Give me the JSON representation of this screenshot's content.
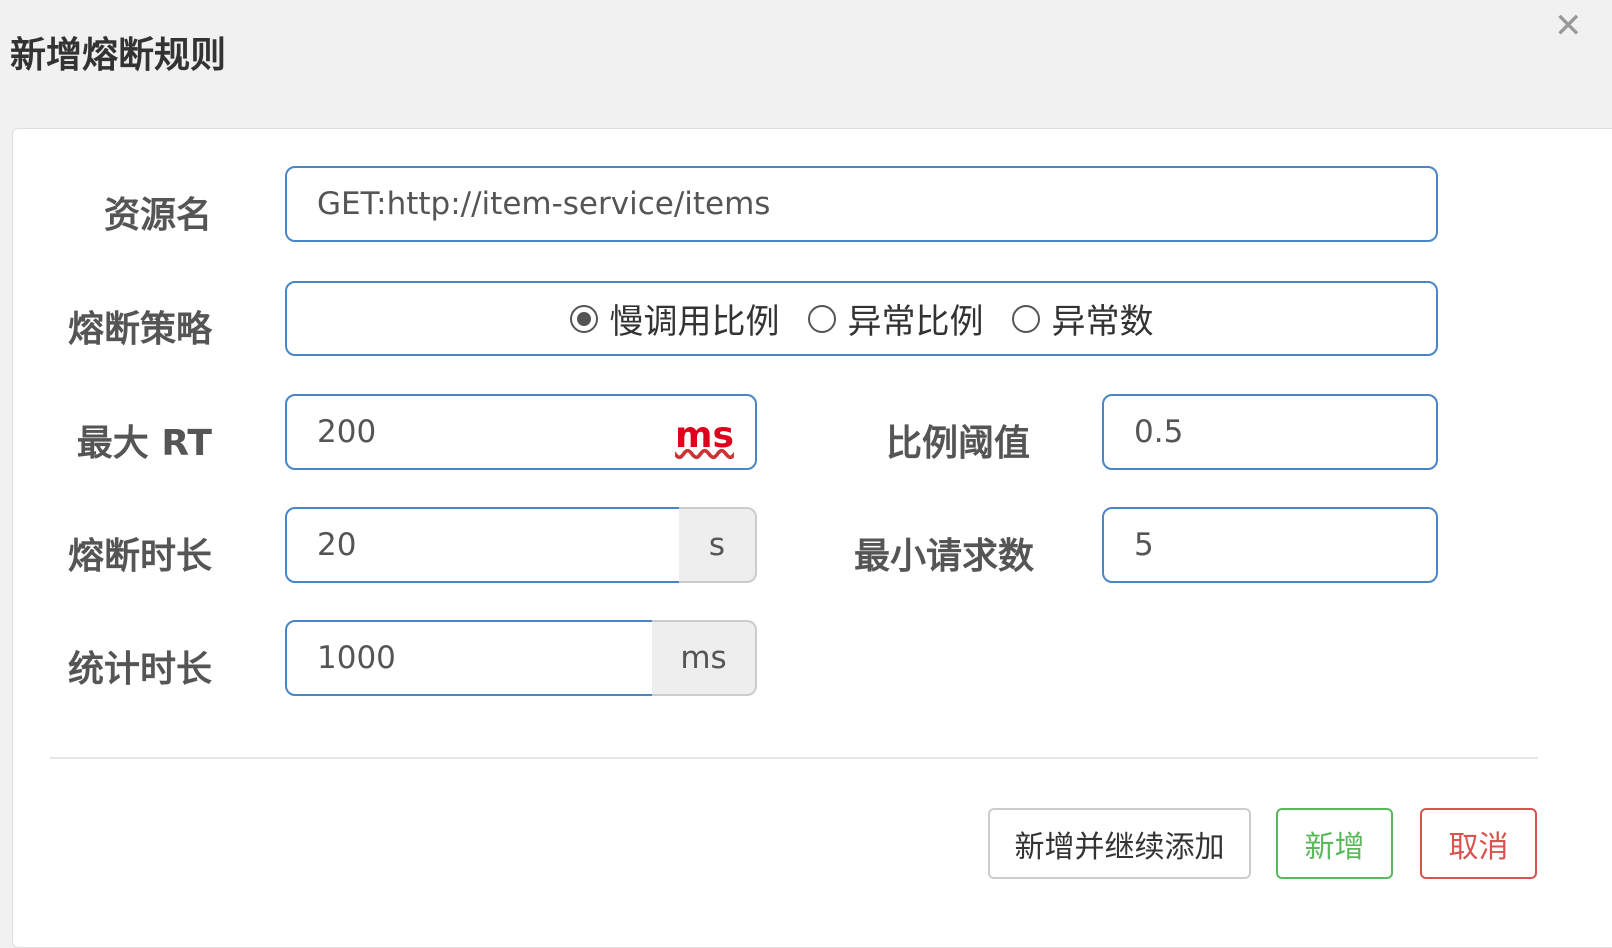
{
  "dialog": {
    "title": "新增熔断规则"
  },
  "form": {
    "resource_label": "资源名",
    "resource_value": "GET:http://item-service/items",
    "strategy_label": "熔断策略",
    "strategy_options": [
      "慢调用比例",
      "异常比例",
      "异常数"
    ],
    "strategy_selected": "慢调用比例",
    "max_rt_label": "最大 RT",
    "max_rt_value": "200",
    "max_rt_unit": "ms",
    "ratio_label": "比例阈值",
    "ratio_value": "0.5",
    "duration_label": "熔断时长",
    "duration_value": "20",
    "duration_unit": "s",
    "min_request_label": "最小请求数",
    "min_request_value": "5",
    "stat_label": "统计时长",
    "stat_value": "1000",
    "stat_unit": "ms"
  },
  "buttons": {
    "add_continue": "新增并继续添加",
    "add": "新增",
    "cancel": "取消"
  },
  "icons": {
    "close": "close-icon"
  },
  "colors": {
    "border_blue": "#4a86c5",
    "add_green": "#5cb85c",
    "cancel_red": "#d9534f",
    "ms_red": "#e0001b"
  }
}
